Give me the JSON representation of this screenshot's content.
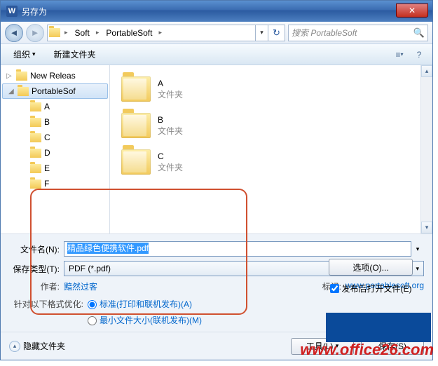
{
  "window": {
    "title": "另存为"
  },
  "breadcrumb": {
    "seg1": "Soft",
    "seg2": "PortableSoft"
  },
  "search": {
    "placeholder": "搜索 PortableSoft"
  },
  "toolbar": {
    "organize": "组织",
    "newfolder": "新建文件夹"
  },
  "tree": {
    "items": [
      {
        "label": "New Releas",
        "level": 1,
        "expander": "▷",
        "selected": false
      },
      {
        "label": "PortableSof",
        "level": 1,
        "expander": "◢",
        "selected": true
      },
      {
        "label": "A",
        "level": 2
      },
      {
        "label": "B",
        "level": 2
      },
      {
        "label": "C",
        "level": 2
      },
      {
        "label": "D",
        "level": 2
      },
      {
        "label": "E",
        "level": 2
      },
      {
        "label": "F",
        "level": 2
      }
    ]
  },
  "files": {
    "type_label": "文件夹",
    "items": [
      {
        "name": "A"
      },
      {
        "name": "B"
      },
      {
        "name": "C"
      }
    ]
  },
  "form": {
    "filename_label": "文件名(N):",
    "filename_value": "精品绿色便携软件.pdf",
    "filetype_label": "保存类型(T):",
    "filetype_value": "PDF (*.pdf)",
    "author_label": "作者:",
    "author_value": "黯然过客",
    "tags_label": "标记:",
    "tags_value": "www.portablesoft.org",
    "optimize_label": "针对以下格式优化:",
    "radio1": "标准(打印和联机发布)(A)",
    "radio2": "最小文件大小(联机发布)(M)",
    "options_button": "选项(O)...",
    "open_after_checkbox": "发布后打开文件(E)"
  },
  "footer": {
    "hide_folders": "隐藏文件夹",
    "tools": "工具(L)",
    "save": "保存(S)"
  },
  "watermark": "www.office26.com"
}
